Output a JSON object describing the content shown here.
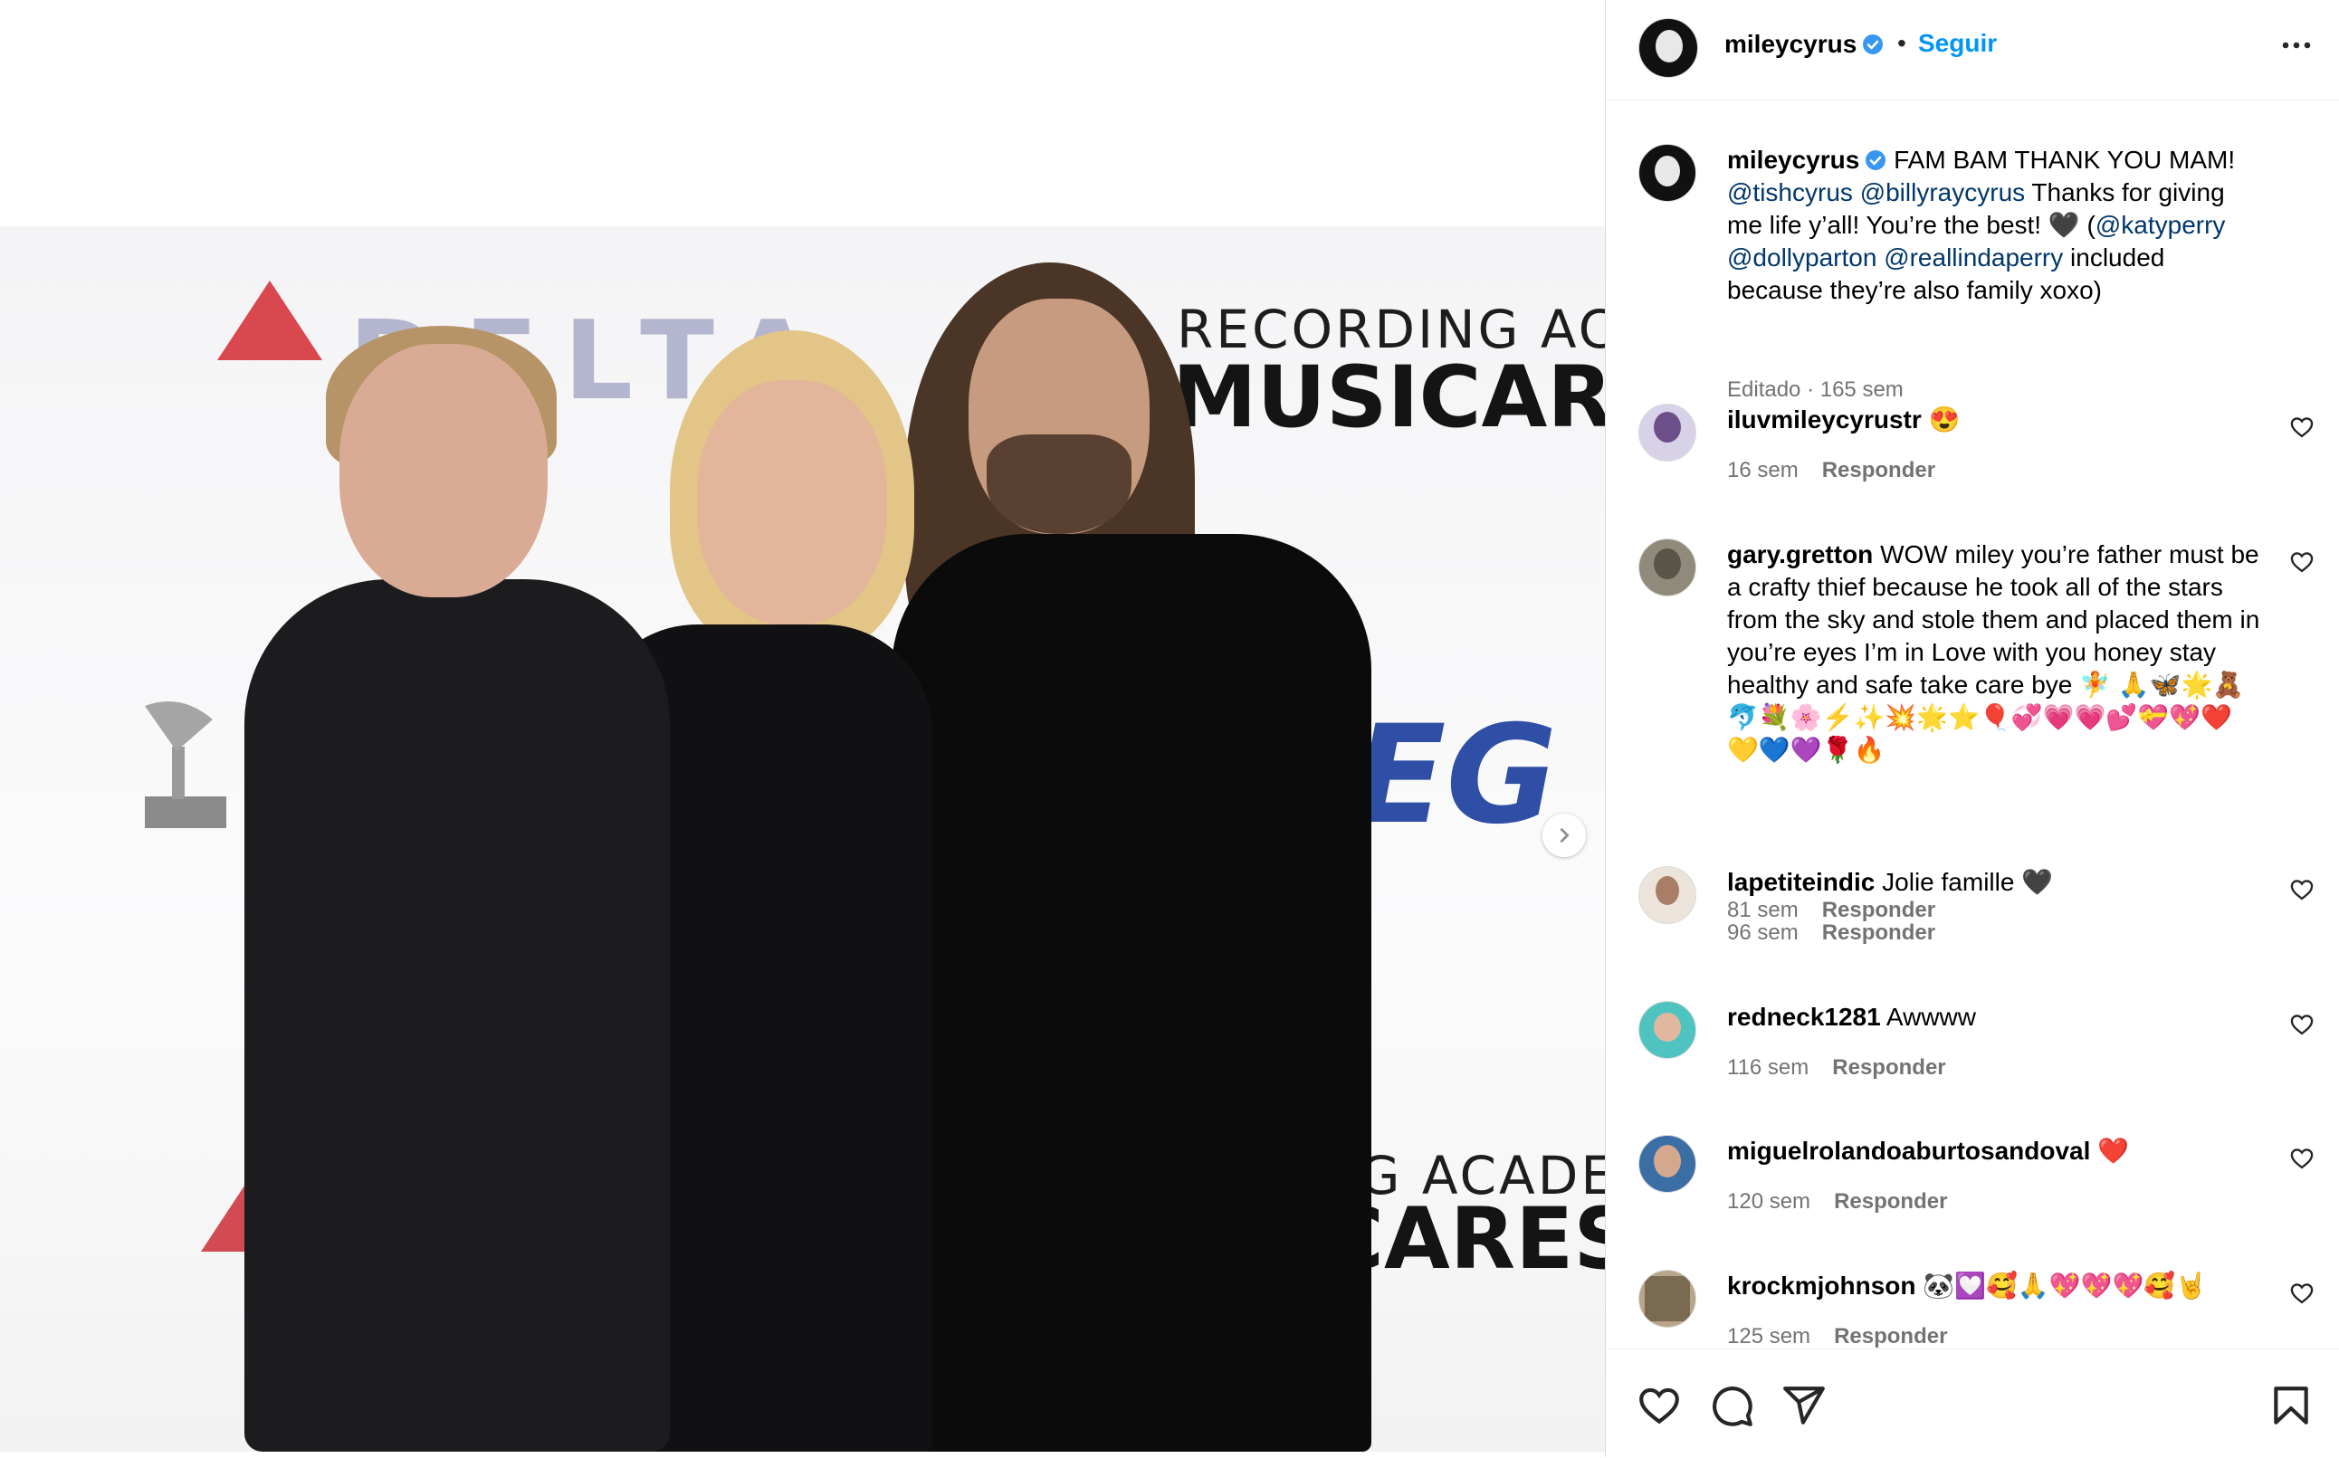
{
  "header": {
    "username": "mileycyrus",
    "separator": "•",
    "follow_label": "Seguir",
    "more_icon": "more-horizontal-icon"
  },
  "post": {
    "sponsors": {
      "delta": "DELTA",
      "recording_top": "RECORDING ACADE",
      "musicares_top": "MUSICARES",
      "recording_bottom": "ING ACADEM",
      "musicares_bottom": "ICARES",
      "aeg": "EG"
    },
    "caption": {
      "username": "mileycyrus",
      "text1": "FAM BAM THANK YOU MAM!",
      "m1": "@tishcyrus",
      "m2": "@billyraycyrus",
      "text2": "Thanks for giving me life y’all! You’re the best! 🖤 (",
      "m3": "@katyperry",
      "m4": "@dollyparton",
      "m5": "@reallindaperry",
      "text3": "included because they’re also family xoxo)",
      "meta": "Editado · 165 sem"
    }
  },
  "comments": [
    {
      "user": "iluvmileycyrustr",
      "text": "😍",
      "time": "16 sem",
      "reply": "Responder"
    },
    {
      "user": "gary.gretton",
      "text": "WOW miley you’re father must be a crafty thief because he took all of the stars from the sky and stole them and placed them in you’re eyes I’m in Love with you honey stay healthy and safe take care bye 🧚 🙏🦋🌟🧸🐬💐🌸⚡✨💥🌟⭐🎈💞💗💗💕💝💖❤️💛💙💜🌹🔥",
      "time": "81 sem",
      "reply": "Responder"
    },
    {
      "user": "lapetiteindic",
      "text": "Jolie famille 🖤",
      "time": "96 sem",
      "reply": "Responder"
    },
    {
      "user": "redneck1281",
      "text": "Awwww",
      "time": "116 sem",
      "reply": "Responder"
    },
    {
      "user": "miguelrolandoaburtosandoval",
      "text": "❤️",
      "time": "120 sem",
      "reply": "Responder"
    },
    {
      "user": "krockmjohnson",
      "text": "🐼💟🥰🙏💖💖💖🥰🤘",
      "time": "125 sem",
      "reply": "Responder"
    }
  ],
  "actions": {
    "like_icon": "heart-icon",
    "comment_icon": "comment-icon",
    "share_icon": "share-icon",
    "save_icon": "bookmark-icon"
  },
  "colors": {
    "accent": "#0095f6",
    "mention": "#00376b",
    "muted": "#737373",
    "verified": "#3897f0"
  }
}
